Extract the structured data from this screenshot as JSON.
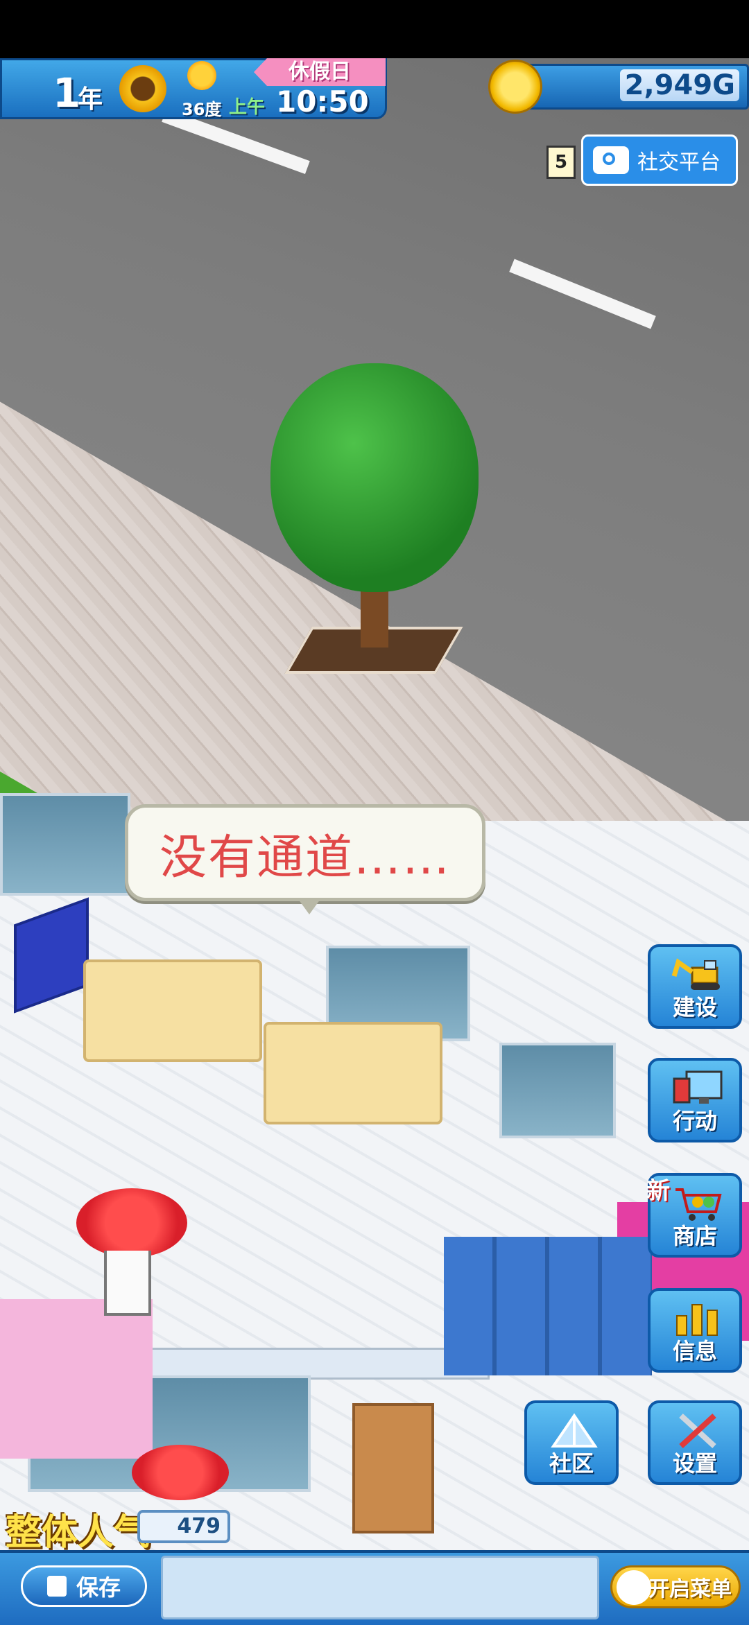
{
  "hud": {
    "year": "1",
    "year_unit": "年",
    "season_icon": "sunflower-icon",
    "weather_icon": "sun-icon",
    "temperature": "36度",
    "period": "上午",
    "time": "10:50",
    "holiday_label": "休假日",
    "money": "2,949G"
  },
  "social": {
    "badge": "5",
    "label": "社交平台",
    "icon": "camera-icon"
  },
  "speech_bubble": "没有通道……",
  "side_menu": [
    {
      "label": "建设",
      "icon": "excavator-icon"
    },
    {
      "label": "行动",
      "icon": "monitor-icon"
    },
    {
      "label": "商店",
      "icon": "shopping-cart-icon",
      "badge": "新"
    },
    {
      "label": "信息",
      "icon": "bar-chart-icon"
    },
    {
      "label": "设置",
      "icon": "wrench-screwdriver-icon"
    }
  ],
  "community": {
    "label": "社区",
    "icon": "tent-icon"
  },
  "popularity": {
    "label": "整体人气",
    "value": "479"
  },
  "bottom_bar": {
    "save_label": "保存",
    "menu_toggle_label": "开启菜单"
  },
  "colors": {
    "hud_blue": "#2584d6",
    "bubble_text": "#e04848",
    "popularity_text": "#ffe34a",
    "toggle_yellow": "#ffd54a"
  }
}
